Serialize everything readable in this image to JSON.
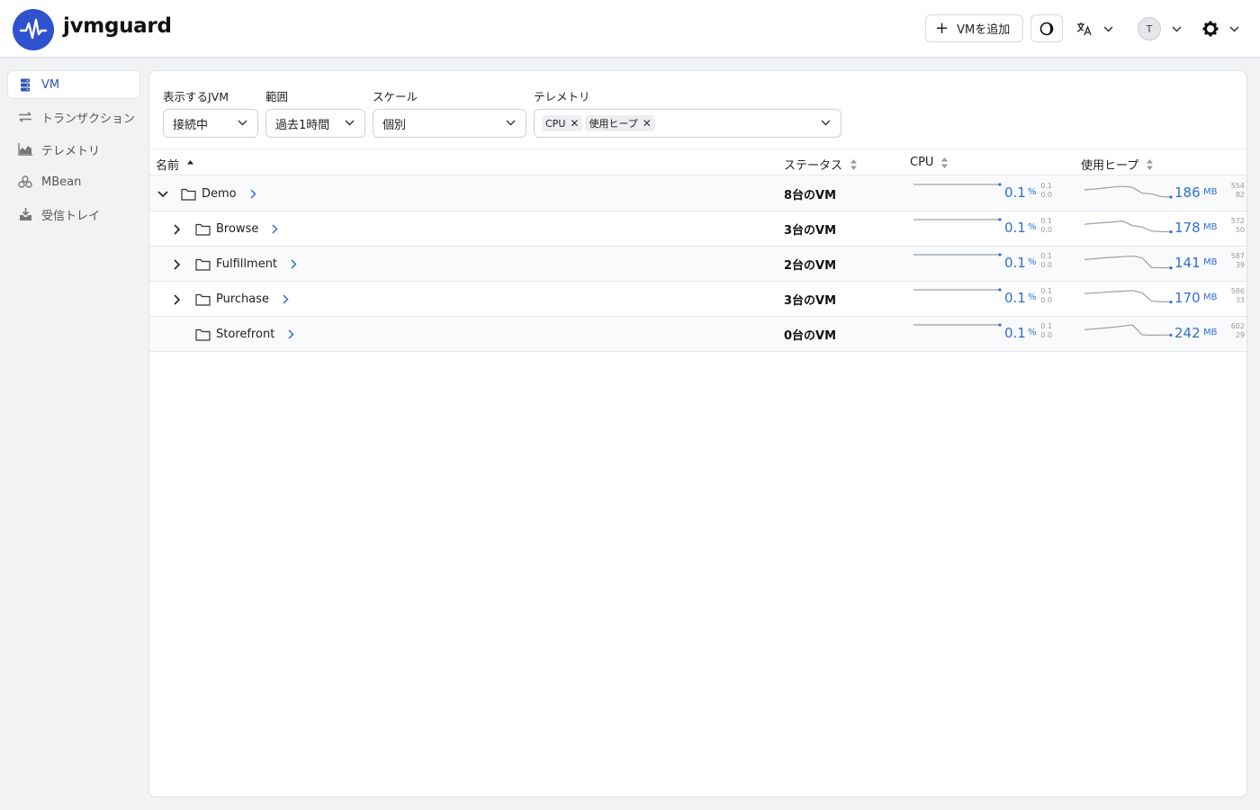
{
  "header": {
    "brand": "jvmguard",
    "add_vm_label": "VMを追加",
    "avatar_initial": "T",
    "icons": [
      "pulse-logo-icon",
      "plus-icon",
      "theme-toggle-icon",
      "translate-icon",
      "gear-icon",
      "chevron-down-icon"
    ]
  },
  "sidebar": {
    "items": [
      {
        "label": "VM",
        "icon": "server-icon",
        "active": true
      },
      {
        "label": "トランザクション",
        "icon": "transactions-icon",
        "active": false
      },
      {
        "label": "テレメトリ",
        "icon": "area-chart-icon",
        "active": false
      },
      {
        "label": "MBean",
        "icon": "beans-icon",
        "active": false
      },
      {
        "label": "受信トレイ",
        "icon": "inbox-icon",
        "active": false
      }
    ]
  },
  "filters": {
    "jvm": {
      "label": "表示するJVM",
      "value": "接続中"
    },
    "range": {
      "label": "範囲",
      "value": "過去1時間"
    },
    "scale": {
      "label": "スケール",
      "value": "個別"
    },
    "telemetry": {
      "label": "テレメトリ",
      "chips": [
        "CPU",
        "使用ヒープ"
      ]
    }
  },
  "table": {
    "columns": {
      "name": "名前",
      "status": "ステータス",
      "cpu": "CPU",
      "heap": "使用ヒープ"
    },
    "rows": [
      {
        "name": "Demo",
        "level": 0,
        "expander": "expanded",
        "status": "8台のVM",
        "cpu": {
          "value": "0.1",
          "unit": "%",
          "max": "0.1",
          "min": "0.0",
          "series": [
            0.1,
            0.1,
            0.1,
            0.1,
            0.1,
            0.1,
            0.1,
            0.1,
            0.1,
            0.1
          ]
        },
        "heap": {
          "value": "186",
          "unit": "MB",
          "max": "554",
          "min": "82",
          "series": [
            400,
            420,
            450,
            480,
            500,
            470,
            300,
            280,
            200,
            186
          ]
        }
      },
      {
        "name": "Browse",
        "level": 1,
        "expander": "collapsed",
        "status": "3台のVM",
        "cpu": {
          "value": "0.1",
          "unit": "%",
          "max": "0.1",
          "min": "0.0",
          "series": [
            0.1,
            0.1,
            0.1,
            0.1,
            0.1,
            0.1,
            0.1,
            0.1,
            0.1,
            0.1
          ]
        },
        "heap": {
          "value": "178",
          "unit": "MB",
          "max": "572",
          "min": "50",
          "series": [
            420,
            450,
            470,
            500,
            520,
            380,
            330,
            200,
            185,
            178
          ]
        }
      },
      {
        "name": "Fulfillment",
        "level": 1,
        "expander": "collapsed",
        "status": "2台のVM",
        "cpu": {
          "value": "0.1",
          "unit": "%",
          "max": "0.1",
          "min": "0.0",
          "series": [
            0.1,
            0.1,
            0.1,
            0.1,
            0.1,
            0.1,
            0.1,
            0.1,
            0.1,
            0.1
          ]
        },
        "heap": {
          "value": "141",
          "unit": "MB",
          "max": "587",
          "min": "39",
          "series": [
            420,
            450,
            480,
            500,
            520,
            540,
            480,
            150,
            145,
            141
          ]
        }
      },
      {
        "name": "Purchase",
        "level": 1,
        "expander": "collapsed",
        "status": "3台のVM",
        "cpu": {
          "value": "0.1",
          "unit": "%",
          "max": "0.1",
          "min": "0.0",
          "series": [
            0.1,
            0.1,
            0.1,
            0.1,
            0.1,
            0.1,
            0.1,
            0.1,
            0.1,
            0.1
          ]
        },
        "heap": {
          "value": "170",
          "unit": "MB",
          "max": "586",
          "min": "33",
          "series": [
            460,
            480,
            500,
            520,
            540,
            560,
            480,
            200,
            180,
            170
          ]
        }
      },
      {
        "name": "Storefront",
        "level": 1,
        "expander": "none",
        "status": "0台のVM",
        "cpu": {
          "value": "0.1",
          "unit": "%",
          "max": "0.1",
          "min": "0.0",
          "series": [
            0.1,
            0.1,
            0.1,
            0.1,
            0.1,
            0.1,
            0.1,
            0.1,
            0.1,
            0.1
          ]
        },
        "heap": {
          "value": "242",
          "unit": "MB",
          "max": "602",
          "min": "29",
          "series": [
            430,
            460,
            490,
            520,
            560,
            600,
            250,
            240,
            242,
            242
          ]
        }
      }
    ]
  },
  "colors": {
    "accent": "#2f56b8",
    "value_blue": "#2f6fd1",
    "logo": "#2f52cf"
  }
}
